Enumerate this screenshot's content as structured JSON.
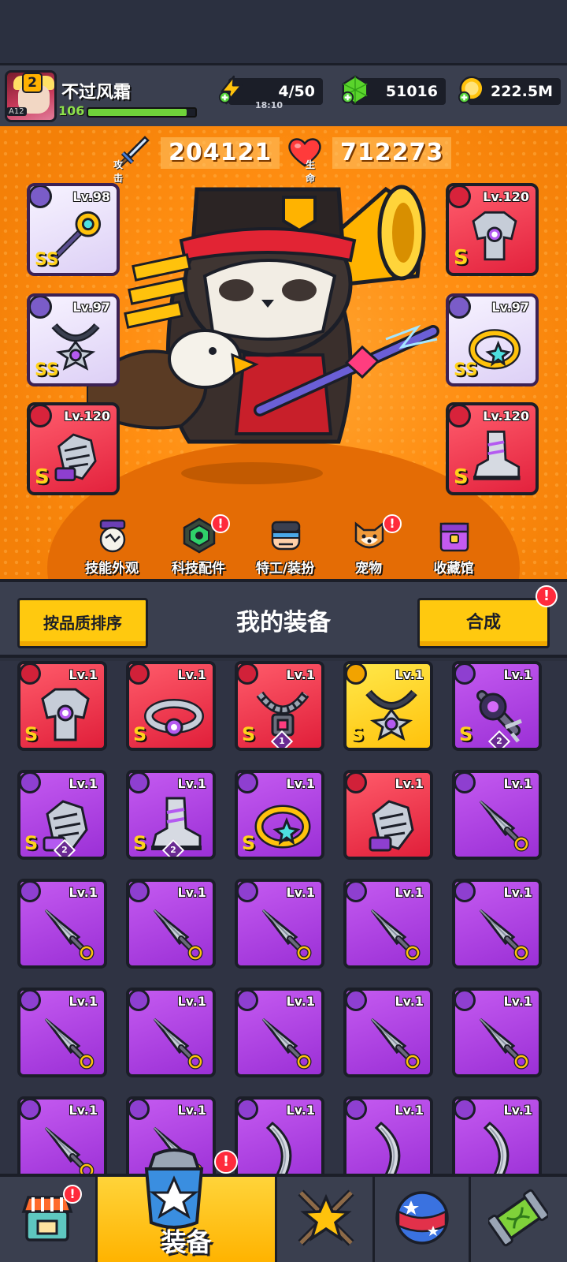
{
  "player": {
    "name": "不过风霜",
    "level_badge": "2",
    "vip_tag": "A12",
    "level": "106",
    "xp_progress": 0.92
  },
  "resources": {
    "energy": "4/50",
    "energy_timer": "18:10",
    "gems": "51016",
    "gold": "222.5M"
  },
  "stats": {
    "attack_value": "204121",
    "attack_label": "攻击",
    "hp_value": "712273",
    "hp_label": "生命"
  },
  "equipped": [
    {
      "slot": "weapon",
      "level": "Lv.98",
      "grade": "SS",
      "icon": "staff-icon"
    },
    {
      "slot": "armor",
      "level": "Lv.120",
      "grade": "S",
      "icon": "armor-icon"
    },
    {
      "slot": "necklace",
      "level": "Lv.97",
      "grade": "SS",
      "icon": "necklace-icon"
    },
    {
      "slot": "ring",
      "level": "Lv.97",
      "grade": "SS",
      "icon": "ring-icon"
    },
    {
      "slot": "gloves",
      "level": "Lv.120",
      "grade": "S",
      "icon": "gauntlet-icon"
    },
    {
      "slot": "boots",
      "level": "Lv.120",
      "grade": "S",
      "icon": "boot-icon"
    }
  ],
  "menu": [
    {
      "label": "技能外观",
      "icon": "skill-skin-icon",
      "alert": false
    },
    {
      "label": "科技配件",
      "icon": "tech-parts-icon",
      "alert": true
    },
    {
      "label": "特工/装扮",
      "icon": "agent-icon",
      "alert": false
    },
    {
      "label": "宠物",
      "icon": "pet-icon",
      "alert": true
    },
    {
      "label": "收藏馆",
      "icon": "collection-icon",
      "alert": false
    }
  ],
  "equip_section": {
    "sort_button": "按品质排序",
    "title": "我的装备",
    "merge_button": "合成",
    "merge_alert": "!"
  },
  "inventory": [
    {
      "level": "Lv.1",
      "grade": "S",
      "rarity": "red",
      "icon": "armor-icon",
      "count": ""
    },
    {
      "level": "Lv.1",
      "grade": "S",
      "rarity": "red",
      "icon": "ring-belt-icon",
      "count": ""
    },
    {
      "level": "Lv.1",
      "grade": "S",
      "rarity": "red",
      "icon": "chain-necklace-icon",
      "count": "1"
    },
    {
      "level": "Lv.1",
      "grade": "S",
      "rarity": "gold",
      "icon": "necklace-icon",
      "count": ""
    },
    {
      "level": "Lv.1",
      "grade": "S",
      "rarity": "purple",
      "icon": "spiked-weapon-icon",
      "count": "2"
    },
    {
      "level": "Lv.1",
      "grade": "S",
      "rarity": "purple",
      "icon": "gauntlet-icon",
      "count": "2"
    },
    {
      "level": "Lv.1",
      "grade": "S",
      "rarity": "purple",
      "icon": "boot-icon",
      "count": "2"
    },
    {
      "level": "Lv.1",
      "grade": "S",
      "rarity": "purple",
      "icon": "ring-icon",
      "count": ""
    },
    {
      "level": "Lv.1",
      "grade": "",
      "rarity": "red",
      "icon": "gauntlet-icon",
      "count": ""
    },
    {
      "level": "Lv.1",
      "grade": "",
      "rarity": "purple",
      "icon": "kunai-icon",
      "count": ""
    },
    {
      "level": "Lv.1",
      "grade": "",
      "rarity": "purple",
      "icon": "kunai-icon",
      "count": ""
    },
    {
      "level": "Lv.1",
      "grade": "",
      "rarity": "purple",
      "icon": "kunai-icon",
      "count": ""
    },
    {
      "level": "Lv.1",
      "grade": "",
      "rarity": "purple",
      "icon": "kunai-icon",
      "count": ""
    },
    {
      "level": "Lv.1",
      "grade": "",
      "rarity": "purple",
      "icon": "kunai-icon",
      "count": ""
    },
    {
      "level": "Lv.1",
      "grade": "",
      "rarity": "purple",
      "icon": "kunai-icon",
      "count": ""
    },
    {
      "level": "Lv.1",
      "grade": "",
      "rarity": "purple",
      "icon": "kunai-icon",
      "count": ""
    },
    {
      "level": "Lv.1",
      "grade": "",
      "rarity": "purple",
      "icon": "kunai-icon",
      "count": ""
    },
    {
      "level": "Lv.1",
      "grade": "",
      "rarity": "purple",
      "icon": "kunai-icon",
      "count": ""
    },
    {
      "level": "Lv.1",
      "grade": "",
      "rarity": "purple",
      "icon": "kunai-icon",
      "count": ""
    },
    {
      "level": "Lv.1",
      "grade": "",
      "rarity": "purple",
      "icon": "kunai-icon",
      "count": ""
    },
    {
      "level": "Lv.1",
      "grade": "",
      "rarity": "purple",
      "icon": "kunai-icon",
      "count": ""
    },
    {
      "level": "Lv.1",
      "grade": "",
      "rarity": "purple",
      "icon": "kunai-icon",
      "count": ""
    },
    {
      "level": "Lv.1",
      "grade": "",
      "rarity": "purple",
      "icon": "blade-icon",
      "count": ""
    },
    {
      "level": "Lv.1",
      "grade": "",
      "rarity": "purple",
      "icon": "blade-icon",
      "count": ""
    },
    {
      "level": "Lv.1",
      "grade": "",
      "rarity": "purple",
      "icon": "blade-icon",
      "count": ""
    }
  ],
  "bottom_nav": [
    {
      "label": "",
      "icon": "shop-icon",
      "alert": true
    },
    {
      "label": "装备",
      "icon": "equipment-icon",
      "alert": true,
      "active": true
    },
    {
      "label": "",
      "icon": "battle-star-icon",
      "alert": false
    },
    {
      "label": "",
      "icon": "planet-ball-icon",
      "alert": false
    },
    {
      "label": "",
      "icon": "lab-capsule-icon",
      "alert": false
    }
  ],
  "colors": {
    "accent_yellow": "#ffc90f",
    "stage_orange": "#ff8e12",
    "rarity_red": "#e3223d",
    "rarity_purple": "#9b30d6",
    "rarity_gold": "#ffc20c",
    "panel_dark": "#3a3f4f"
  }
}
